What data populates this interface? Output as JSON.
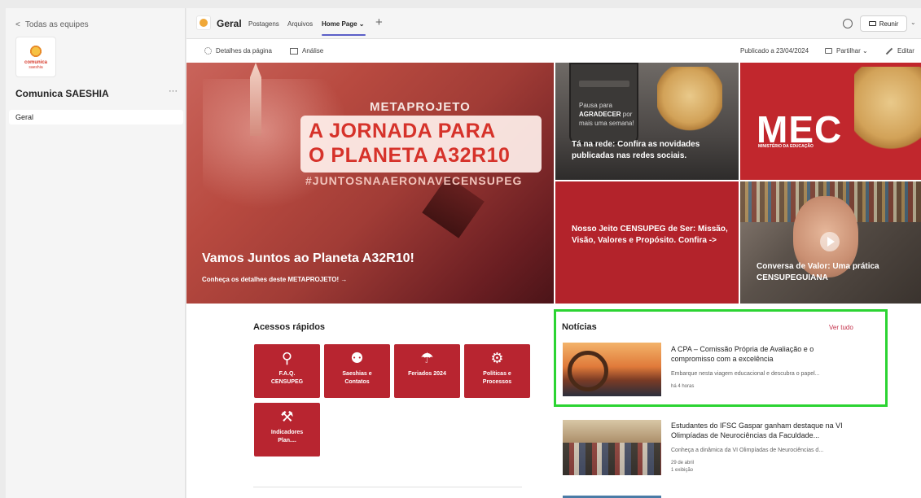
{
  "sidebar": {
    "back_link": "Todas as equipes",
    "back_chevron": "<",
    "logo_text_1": "comunica",
    "logo_text_2": "saeshia",
    "team_name": "Comunica SAESHIA",
    "more": "···",
    "channels": [
      {
        "label": "Geral"
      }
    ]
  },
  "tabbar": {
    "channel": "Geral",
    "tabs": [
      {
        "label": "Postagens"
      },
      {
        "label": "Arquivos"
      },
      {
        "label": "Home Page ⌄"
      }
    ],
    "add": "+",
    "meet_label": "Reunir",
    "meet_chevron": "⌄"
  },
  "commands": {
    "details": "Detalhes da página",
    "analytics": "Análise",
    "published": "Publicado a 23/04/2024",
    "share": "Partilhar ⌄",
    "edit": "Editar"
  },
  "hero": {
    "main": {
      "overline": "METAPROJETO",
      "headline_1": "A JORNADA PARA",
      "headline_2": "O PLANETA A32R10",
      "hashtag": "#JUNTOSNAAERONAVECENSUPEG",
      "title": "Vamos Juntos ao Planeta A32R10!",
      "subtitle": "Conheça os detalhes deste METAPROJETO! →"
    },
    "tiles": [
      {
        "title": "Tá na rede: Confira as novidades publicadas nas redes sociais.",
        "phone_text_1": "Pausa para",
        "phone_text_2": "AGRADECER",
        "phone_text_3": "por",
        "phone_text_4": "mais uma semana!"
      },
      {
        "brand": "MEC",
        "brand_sub": "MINISTÉRIO DA EDUCAÇÃO"
      },
      {
        "title": "Nosso Jeito CENSUPEG de Ser: Missão, Visão, Valores e Propósito. Confira ->"
      },
      {
        "title": "Conversa de Valor: Uma prática CENSUPEGUIANA"
      }
    ]
  },
  "quick_links": {
    "heading": "Acessos rápidos",
    "items": [
      {
        "label_1": "F.A.Q.",
        "label_2": "CENSUPEG",
        "icon": "search-question-icon"
      },
      {
        "label_1": "Saeshias e",
        "label_2": "Contatos",
        "icon": "people-icon"
      },
      {
        "label_1": "Feriados 2024",
        "label_2": "",
        "icon": "umbrella-beach-icon"
      },
      {
        "label_1": "Políticas e",
        "label_2": "Processos",
        "icon": "gears-icon"
      },
      {
        "label_1": "Indicadores",
        "label_2": "Plan....",
        "icon": "chart-icon"
      }
    ]
  },
  "news": {
    "heading": "Notícias",
    "see_all": "Ver tudo",
    "items": [
      {
        "title": "A CPA – Comissão Própria de Avaliação e o compromisso com a excelência",
        "description": "Embarque nesta viagem educacional e descubra o papel...",
        "time": "há 4 horas"
      },
      {
        "title": "Estudantes do IFSC Gaspar ganham destaque na VI Olimpíadas de Neurociências da Faculdade...",
        "description": "Conheça a dinâmica da VI Olimpíadas de Neurociências d...",
        "date": "29 de abril",
        "views": "1 exibição"
      }
    ]
  },
  "colors": {
    "accent": "#5b5fc7",
    "brand_red": "#b82530",
    "highlight_green": "#2bd432"
  }
}
